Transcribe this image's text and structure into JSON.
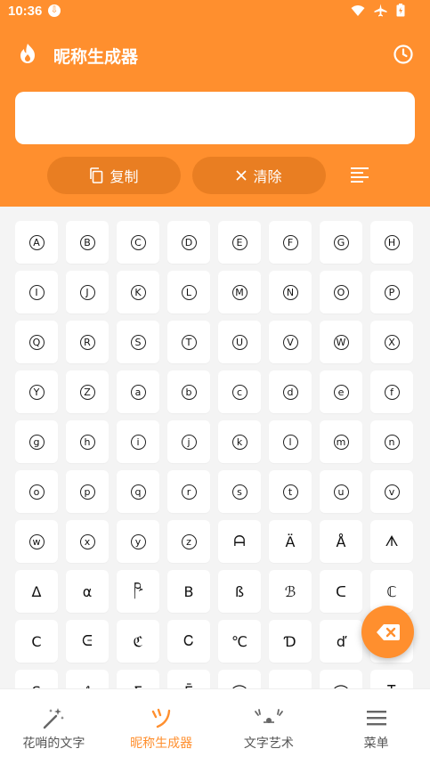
{
  "status": {
    "time": "10:36"
  },
  "header": {
    "title": "昵称生成器"
  },
  "input": {
    "value": "",
    "placeholder": ""
  },
  "actions": {
    "copy_label": "复制",
    "clear_label": "清除"
  },
  "symbols": [
    "A",
    "B",
    "C",
    "D",
    "E",
    "F",
    "G",
    "H",
    "I",
    "J",
    "K",
    "L",
    "M",
    "N",
    "O",
    "P",
    "Q",
    "R",
    "S",
    "T",
    "U",
    "V",
    "W",
    "X",
    "Y",
    "Z",
    "a",
    "b",
    "c",
    "d",
    "e",
    "f",
    "g",
    "h",
    "i",
    "j",
    "k",
    "l",
    "m",
    "n",
    "o",
    "p",
    "q",
    "r",
    "s",
    "t",
    "u",
    "v",
    "w",
    "x",
    "y",
    "z",
    "ᗩ",
    "Ä",
    "Å",
    "ᗑ",
    "Δ",
    "α",
    "ཥ",
    "B",
    "ß",
    "ℬ",
    "ᑕ",
    "ℂ",
    "C",
    "ᕮ",
    "ℭ",
    "Ꮯ",
    "℃",
    "Ɗ",
    "ď",
    "",
    "S",
    "ℓ",
    "Σ",
    "Ē",
    "⌒",
    "",
    "⌒",
    "Ꮖ"
  ],
  "circled_count": 52,
  "nav": [
    {
      "label": "花哨的文字",
      "icon": "magic-wand-icon",
      "active": false
    },
    {
      "label": "昵称生成器",
      "icon": "smiley-tsu-icon",
      "active": true
    },
    {
      "label": "文字艺术",
      "icon": "kaomoji-icon",
      "active": false
    },
    {
      "label": "菜单",
      "icon": "menu-icon",
      "active": false
    }
  ],
  "colors": {
    "accent": "#ff8f2e",
    "button": "#e97e22",
    "background": "#f4f4f4"
  }
}
